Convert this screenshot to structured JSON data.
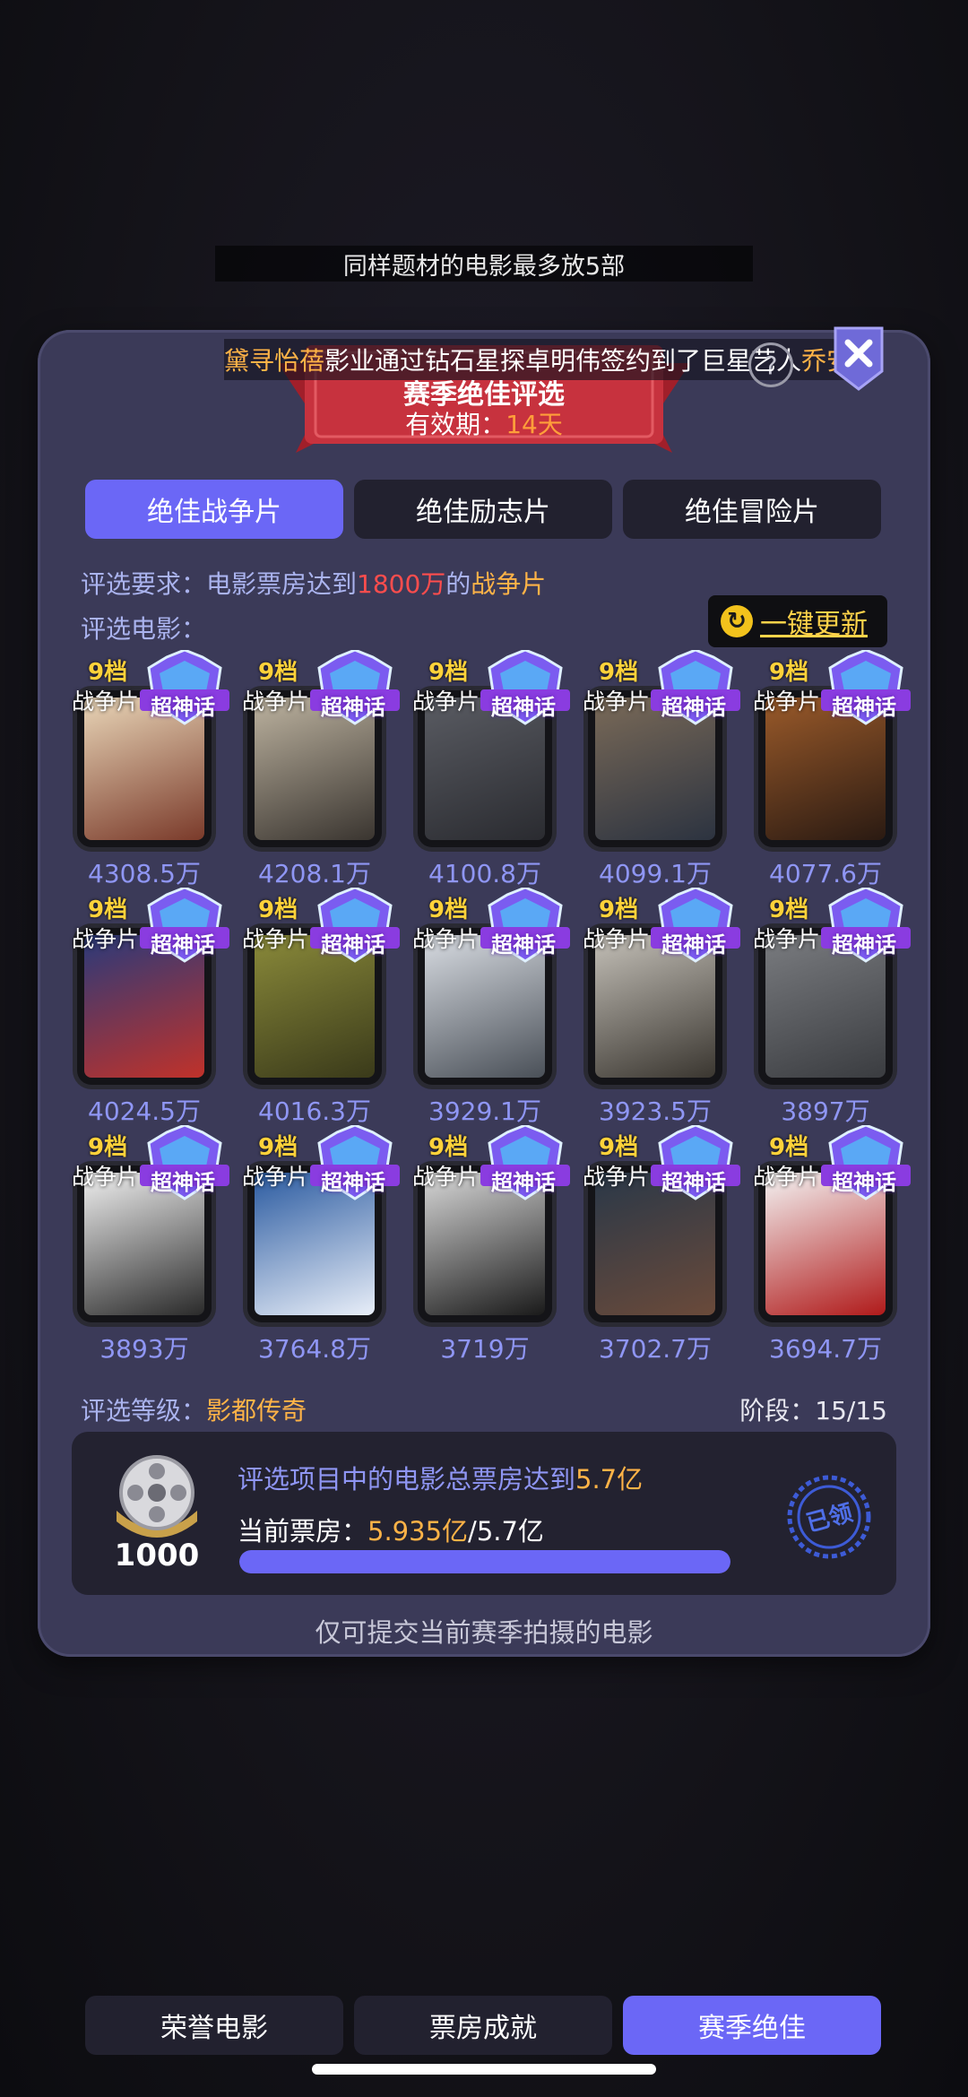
{
  "notice": "同样题材的电影最多放5部",
  "marquee": {
    "name1": "黛寻怡蓓",
    "mid": "影业通过钻石星探卓明伟签约到了巨星艺人",
    "name2": "乔安"
  },
  "banner": {
    "title": "赛季绝佳评选",
    "validity_label": "有效期：",
    "validity_days": "14天"
  },
  "tabs": [
    "绝佳战争片",
    "绝佳励志片",
    "绝佳冒险片"
  ],
  "requirement": {
    "prefix": "评选要求：电影票房达到",
    "amount": "1800万",
    "mid": "的",
    "genre": "战争片"
  },
  "films_label": "评选电影：",
  "refresh_label": "一键更新",
  "films": [
    {
      "grade": "9档",
      "genre": "战争片",
      "badge": "超神话",
      "box": "4308.5万"
    },
    {
      "grade": "9档",
      "genre": "战争片",
      "badge": "超神话",
      "box": "4208.1万"
    },
    {
      "grade": "9档",
      "genre": "战争片",
      "badge": "超神话",
      "box": "4100.8万"
    },
    {
      "grade": "9档",
      "genre": "战争片",
      "badge": "超神话",
      "box": "4099.1万"
    },
    {
      "grade": "9档",
      "genre": "战争片",
      "badge": "超神话",
      "box": "4077.6万"
    },
    {
      "grade": "9档",
      "genre": "战争片",
      "badge": "超神话",
      "box": "4024.5万"
    },
    {
      "grade": "9档",
      "genre": "战争片",
      "badge": "超神话",
      "box": "4016.3万"
    },
    {
      "grade": "9档",
      "genre": "战争片",
      "badge": "超神话",
      "box": "3929.1万"
    },
    {
      "grade": "9档",
      "genre": "战争片",
      "badge": "超神话",
      "box": "3923.5万"
    },
    {
      "grade": "9档",
      "genre": "战争片",
      "badge": "超神话",
      "box": "3897万"
    },
    {
      "grade": "9档",
      "genre": "战争片",
      "badge": "超神话",
      "box": "3893万"
    },
    {
      "grade": "9档",
      "genre": "战争片",
      "badge": "超神话",
      "box": "3764.8万"
    },
    {
      "grade": "9档",
      "genre": "战争片",
      "badge": "超神话",
      "box": "3719万"
    },
    {
      "grade": "9档",
      "genre": "战争片",
      "badge": "超神话",
      "box": "3702.7万"
    },
    {
      "grade": "9档",
      "genre": "战争片",
      "badge": "超神话",
      "box": "3694.7万"
    }
  ],
  "level": {
    "label": "评选等级：",
    "value": "影都传奇"
  },
  "stage": "阶段：15/15",
  "reward": {
    "count": "1000",
    "desc_prefix": "评选项目中的电影总票房达到",
    "desc_target": "5.7亿",
    "current_label": "当前票房：",
    "current_value": "5.935亿",
    "current_target": "/5.7亿",
    "progress": 1.0,
    "claimed": "已领"
  },
  "footer_note": "仅可提交当前赛季拍摄的电影",
  "bottom_tabs": [
    "荣誉电影",
    "票房成就",
    "赛季绝佳"
  ],
  "colors": {
    "accent": "#6b67f6",
    "gold": "#ffb347",
    "red": "#ff4d4d",
    "panel": "#3b3a58"
  }
}
